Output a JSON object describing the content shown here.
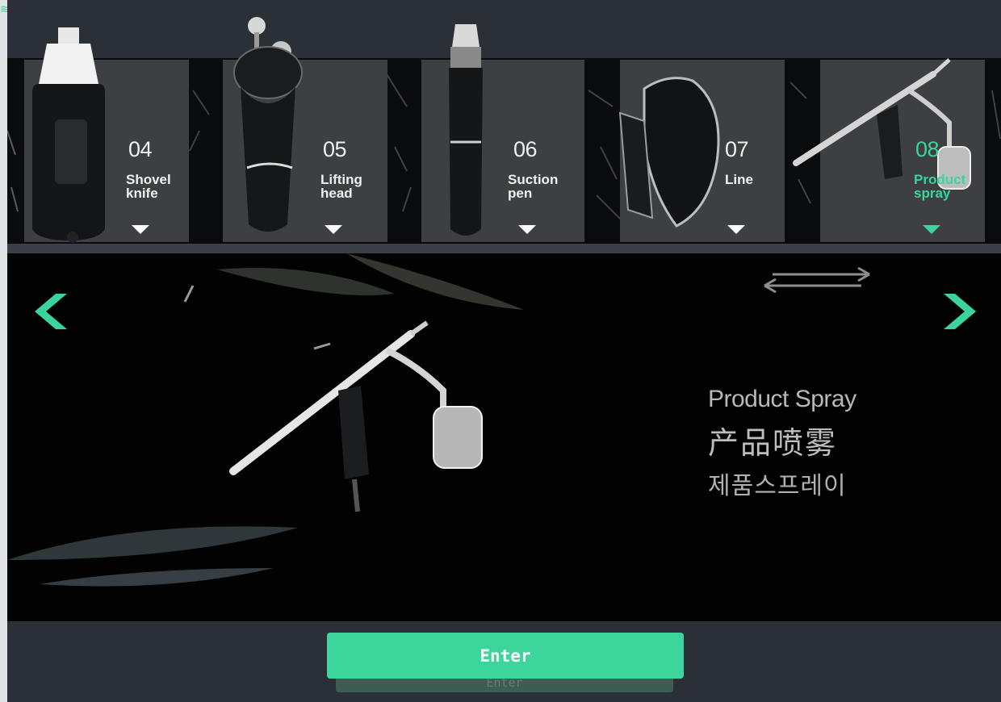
{
  "colors": {
    "accent": "#3ad49c",
    "background": "#2b2f36",
    "panel": "#3d3f42",
    "stage": "#020203"
  },
  "carousel": {
    "items": [
      {
        "number": "04",
        "label": "Shovel\nknife",
        "icon": "shovel-knife-device",
        "active": false
      },
      {
        "number": "05",
        "label": "Lifting\nhead",
        "icon": "lifting-head-device",
        "active": false
      },
      {
        "number": "06",
        "label": "Suction\npen",
        "icon": "suction-pen-device",
        "active": false
      },
      {
        "number": "07",
        "label": "Line",
        "icon": "line-device",
        "active": false
      },
      {
        "number": "08",
        "label": "Product\nspray",
        "icon": "product-spray-device",
        "active": true
      }
    ]
  },
  "main": {
    "prev_icon": "chevron-left-icon",
    "next_icon": "chevron-right-icon",
    "swap_icon": "swap-arrows-icon",
    "caption_en": "Product Spray",
    "caption_zh": "产品喷雾",
    "caption_ko": "제품스프레이",
    "image_icon": "airbrush-spray-gun"
  },
  "footer": {
    "enter_label": "Enter",
    "enter_shadow_label": "Enter"
  }
}
